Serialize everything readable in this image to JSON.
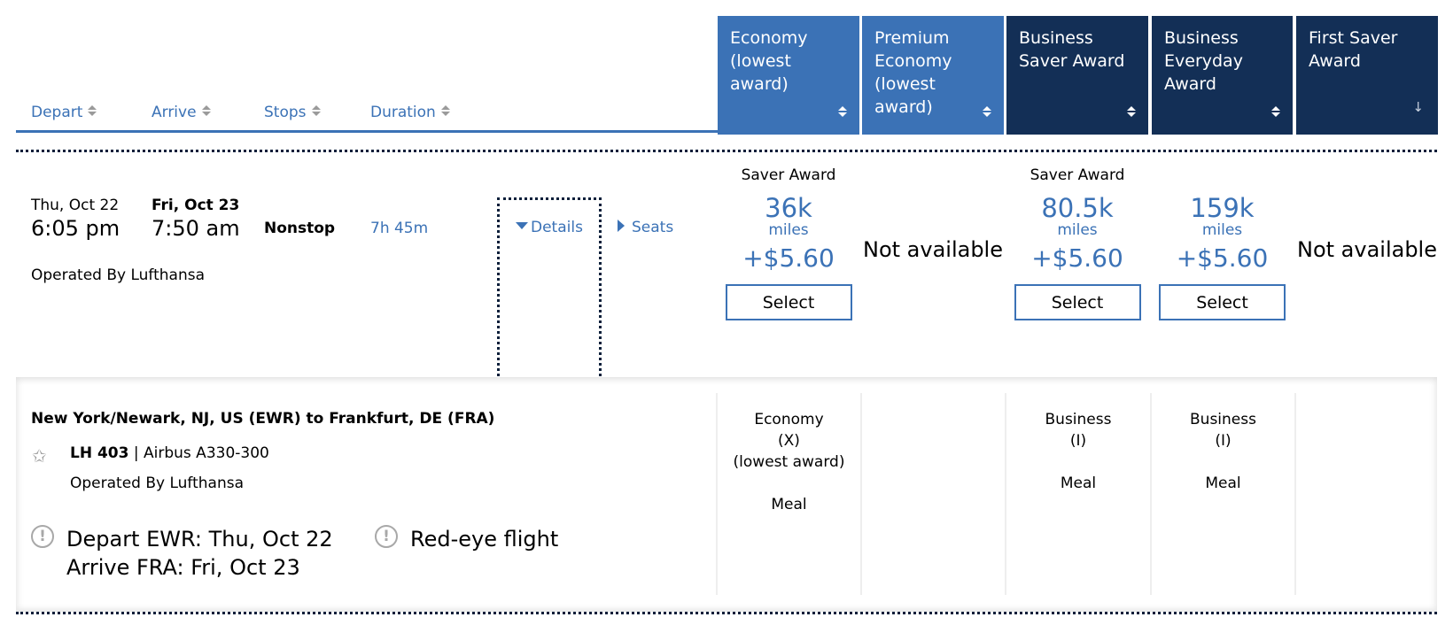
{
  "sort_headers": [
    {
      "label": "Depart"
    },
    {
      "label": "Arrive"
    },
    {
      "label": "Stops"
    },
    {
      "label": "Duration"
    }
  ],
  "fare_columns": [
    {
      "lines": [
        "Economy",
        "(lowest",
        "award)"
      ],
      "sort": "both",
      "theme": "light"
    },
    {
      "lines": [
        "Premium",
        "Economy",
        "(lowest",
        "award)"
      ],
      "sort": "both",
      "theme": "light"
    },
    {
      "lines": [
        "Business",
        "Saver Award"
      ],
      "sort": "both",
      "theme": "dark"
    },
    {
      "lines": [
        "Business",
        "Everyday",
        "Award"
      ],
      "sort": "both",
      "theme": "dark"
    },
    {
      "lines": [
        "First Saver",
        "Award"
      ],
      "sort": "desc",
      "theme": "dark"
    }
  ],
  "flight": {
    "depart_date": "Thu, Oct 22",
    "depart_time": "6:05 pm",
    "arrive_date": "Fri, Oct 23",
    "arrive_time": "7:50 am",
    "stops": "Nonstop",
    "duration": "7h 45m",
    "operated_by": "Operated By Lufthansa",
    "details_label": "Details",
    "seats_label": "Seats"
  },
  "fares": [
    {
      "label": "Saver Award",
      "miles": "36k",
      "miles_unit": "miles",
      "tax": "+$5.60",
      "button": "Select",
      "available": true
    },
    {
      "available": false,
      "text": "Not available"
    },
    {
      "label": "Saver Award",
      "miles": "80.5k",
      "miles_unit": "miles",
      "tax": "+$5.60",
      "button": "Select",
      "available": true
    },
    {
      "label": "",
      "miles": "159k",
      "miles_unit": "miles",
      "tax": "+$5.60",
      "button": "Select",
      "available": true
    },
    {
      "available": false,
      "text": "Not available"
    }
  ],
  "details": {
    "route": "New York/Newark, NJ, US (EWR) to Frankfurt, DE (FRA)",
    "flight_number": "LH 403",
    "separator": "|",
    "aircraft": "Airbus A330-300",
    "operated_by": "Operated By Lufthansa",
    "notice_dates_line1": "Depart EWR: Thu, Oct 22",
    "notice_dates_line2": "Arrive FRA: Fri, Oct 23",
    "notice_redeye": "Red-eye flight",
    "cabins": [
      {
        "lines": [
          "Economy",
          "(X)",
          "(lowest award)",
          "",
          "Meal"
        ]
      },
      {
        "lines": []
      },
      {
        "lines": [
          "Business",
          "(I)",
          "",
          "Meal"
        ]
      },
      {
        "lines": [
          "Business",
          "(I)",
          "",
          "Meal"
        ]
      },
      {
        "lines": []
      }
    ]
  },
  "colors": {
    "accent_blue": "#3b72b6",
    "dark_navy": "#132f56",
    "dotted_border": "#0b1f3a"
  }
}
